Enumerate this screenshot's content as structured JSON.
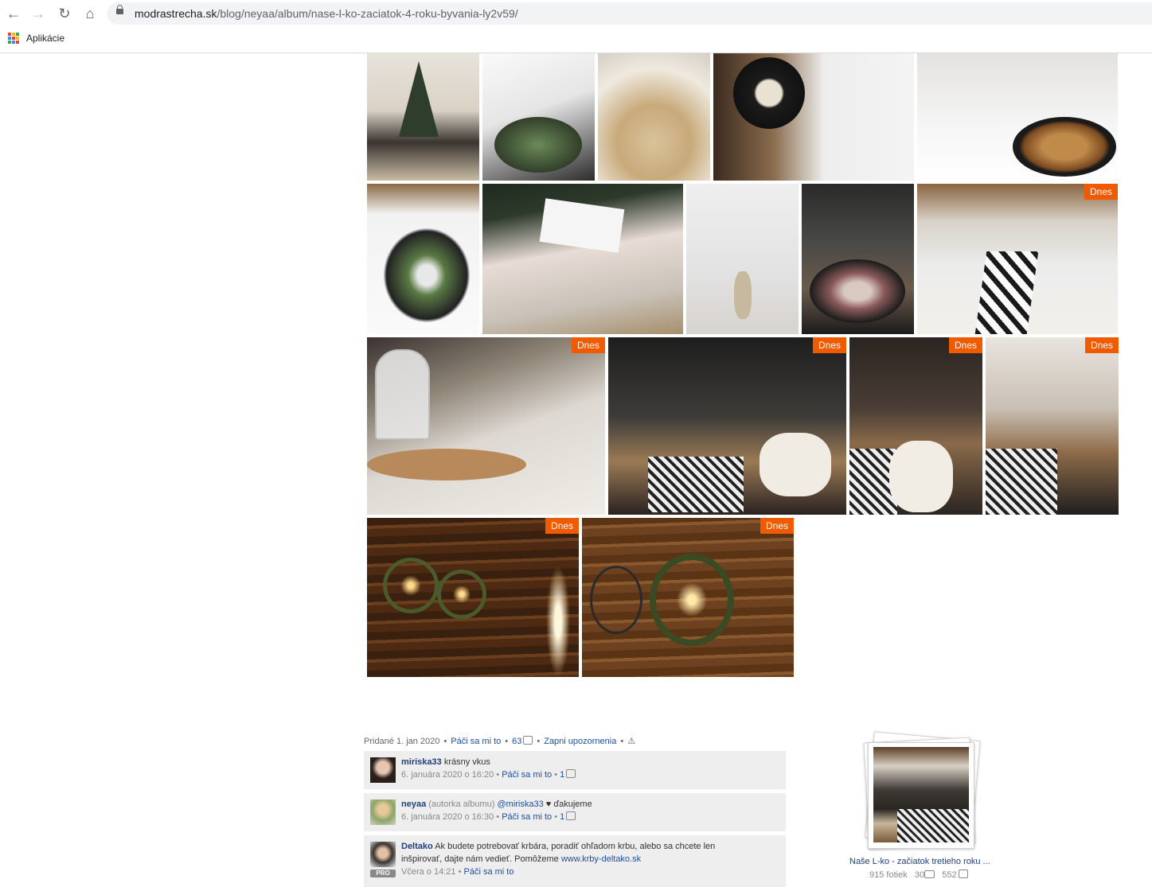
{
  "browser": {
    "url_host": "modrastrecha.sk",
    "url_path": "/blog/neyaa/album/nase-l-ko-zaciatok-4-roku-byvania-ly2v59/",
    "bookmarks": [
      {
        "label": "Aplikácie"
      }
    ]
  },
  "gallery": {
    "new_badge": "Dnes"
  },
  "post": {
    "added_label": "Pridané 1. jan 2020",
    "like_label": "Páči sa mi to",
    "like_count": "63",
    "notify_label": "Zapni upozornenia"
  },
  "comments": [
    {
      "user": "miriska33",
      "note": "",
      "text": "krásny vkus",
      "date": "6. januára 2020 o 16:20",
      "like_label": "Páči sa mi to",
      "likes": "1"
    },
    {
      "user": "neyaa",
      "note": "(autorka albumu)",
      "mention": "@miriska33",
      "text": "♥ ďakujeme",
      "date": "6. januára 2020 o 16:30",
      "like_label": "Páči sa mi to",
      "likes": "1"
    },
    {
      "user": "Deltako",
      "text1": "Ak budete potrebovať krbára, poradiť ohľadom krbu, alebo sa chcete len",
      "text2": "inšpirovať, dajte nám vedieť. Pomôžeme",
      "link": "www.krby-deltako.sk",
      "badge": "PRO",
      "date": "Včera o 14:21",
      "like_label": "Páči sa mi to"
    }
  ],
  "album_card": {
    "title": "Naše L-ko - začiatok tretieho roku ...",
    "photos": "915 fotiek",
    "comments": "30",
    "likes": "552"
  }
}
